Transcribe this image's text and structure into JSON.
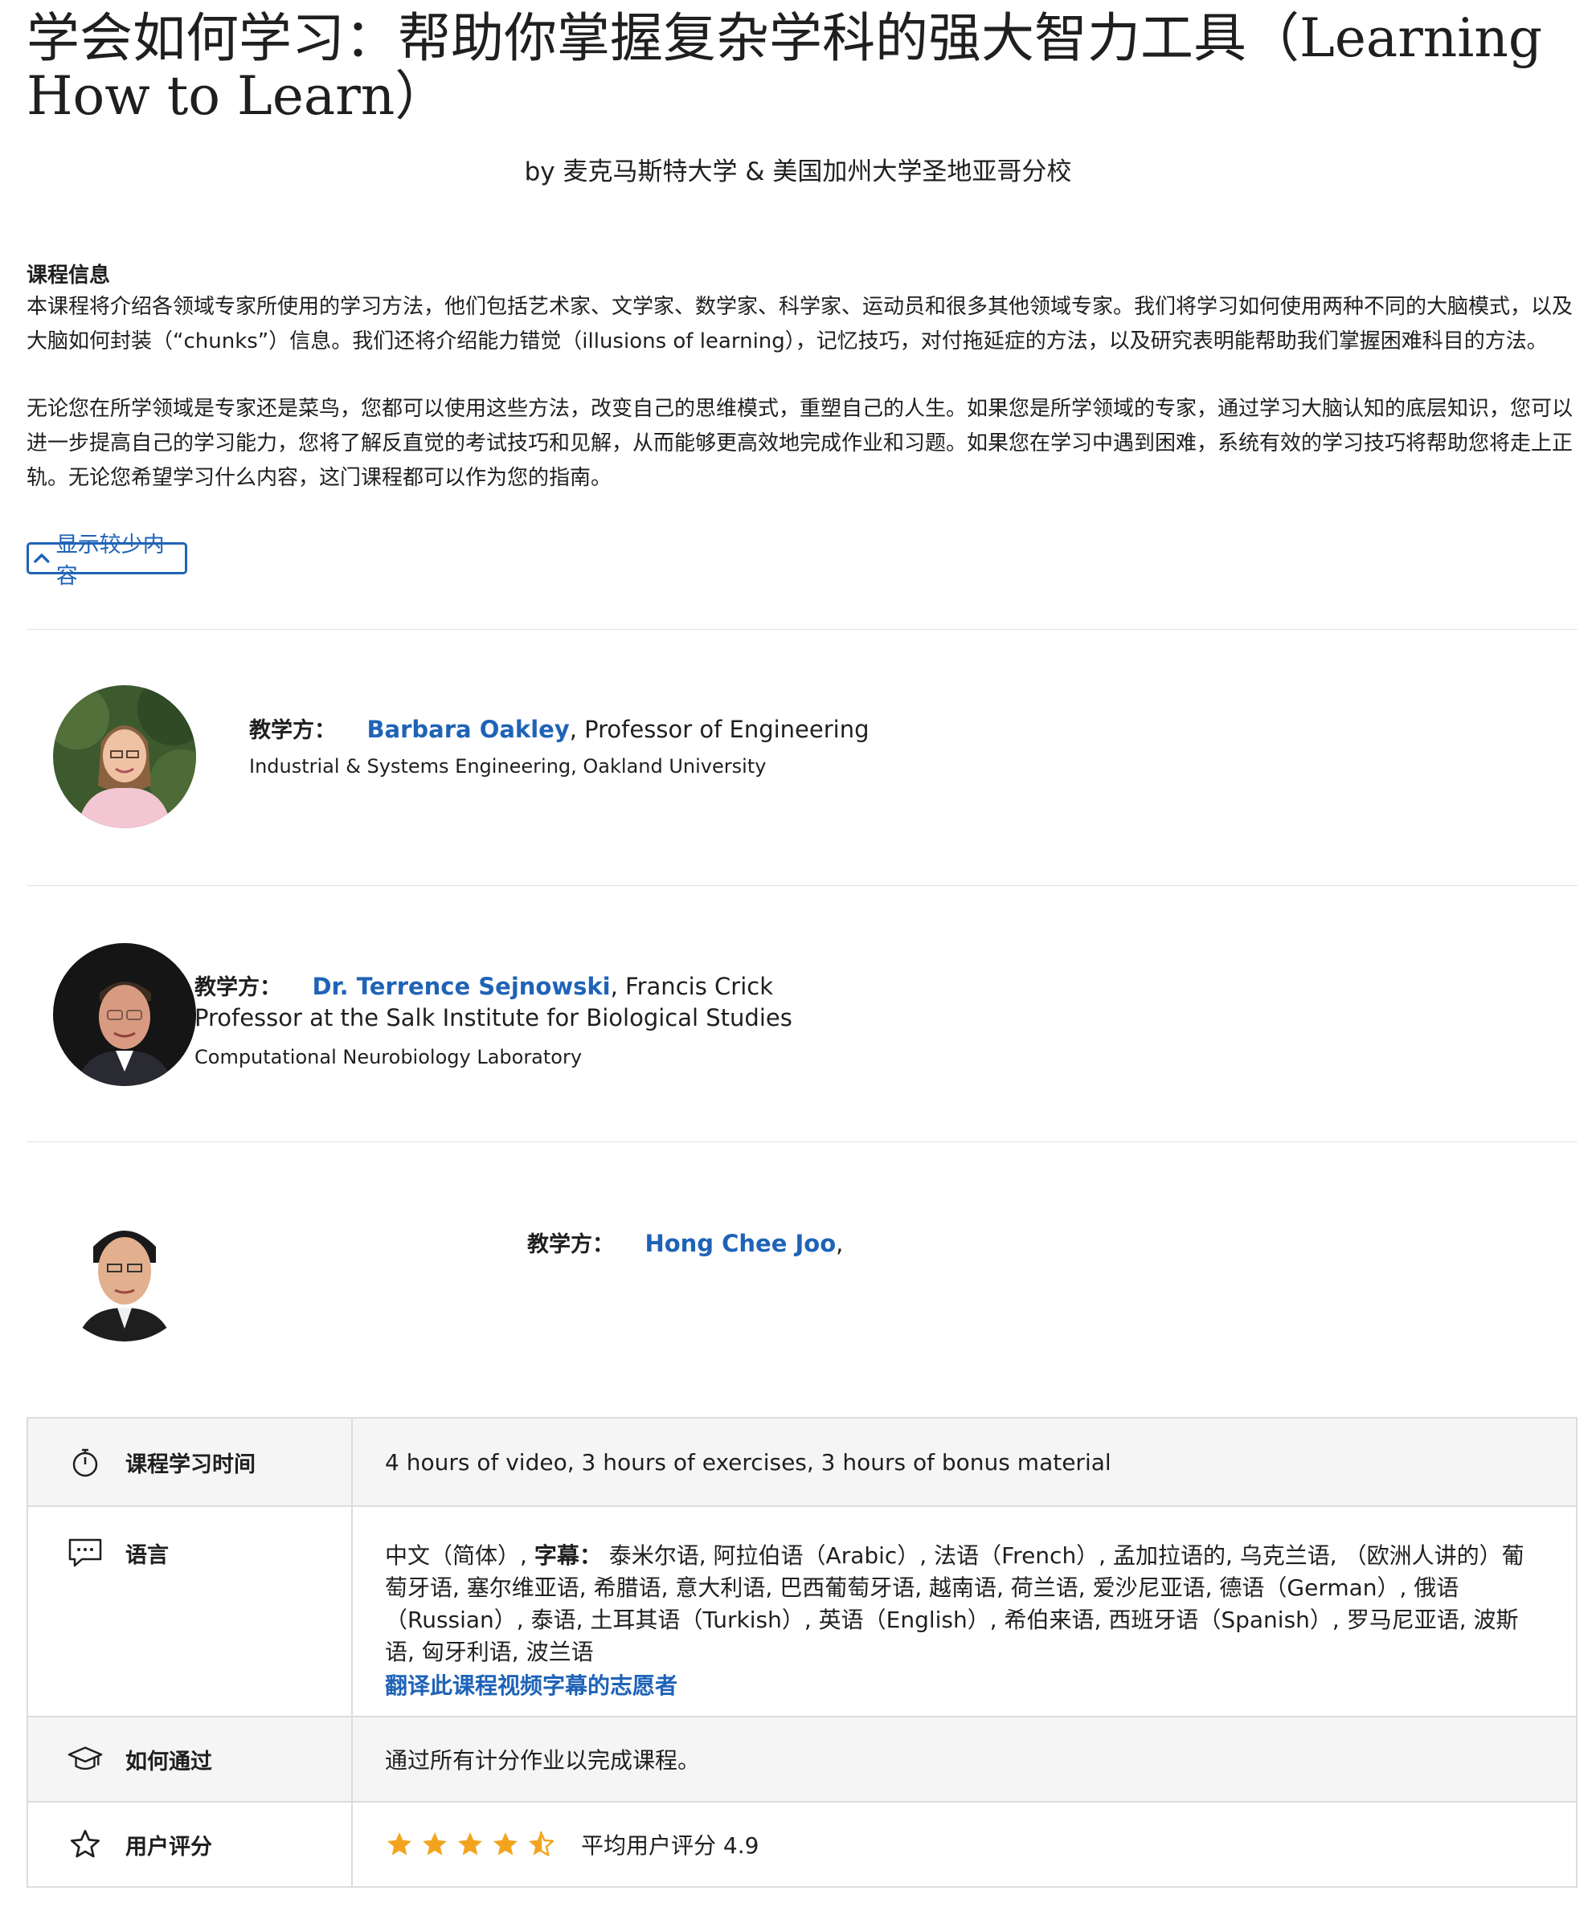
{
  "course": {
    "title": "学会如何学习：帮助你掌握复杂学科的强大智力工具（Learning How to Learn）",
    "byline": "by 麦克马斯特大学 & 美国加州大学圣地亚哥分校"
  },
  "about": {
    "heading": "课程信息",
    "paragraph1": "本课程将介绍各领域专家所使用的学习方法，他们包括艺术家、文学家、数学家、科学家、运动员和很多其他领域专家。我们将学习如何使用两种不同的大脑模式，以及大脑如何封装（“chunks”）信息。我们还将介绍能力错觉（illusions of learning），记忆技巧，对付拖延症的方法，以及研究表明能帮助我们掌握困难科目的方法。",
    "paragraph2": "无论您在所学领域是专家还是菜鸟，您都可以使用这些方法，改变自己的思维模式，重塑自己的人生。如果您是所学领域的专家，通过学习大脑认知的底层知识，您可以进一步提高自己的学习能力，您将了解反直觉的考试技巧和见解，从而能够更高效地完成作业和习题。如果您在学习中遇到困难，系统有效的学习技巧将帮助您将走上正轨。无论您希望学习什么内容，这门课程都可以作为您的指南。",
    "show_less": "显示较少内容"
  },
  "instructors": [
    {
      "label": "教学方：",
      "name": "Barbara Oakley",
      "title": ", Professor of Engineering",
      "org": "Industrial & Systems Engineering, Oakland University"
    },
    {
      "label": "教学方：",
      "name": "Dr. Terrence Sejnowski",
      "title": ", Francis Crick",
      "title2": "Professor at the Salk Institute for Biological Studies",
      "org": "Computational Neurobiology Laboratory"
    },
    {
      "label": "教学方：",
      "name": "Hong Chee Joo",
      "title": ","
    }
  ],
  "info": {
    "duration_label": "课程学习时间",
    "duration_value": "4 hours of video, 3 hours of exercises, 3 hours of bonus material",
    "language_label": "语言",
    "language_primary": "中文（简体）, ",
    "subtitles_label": "字幕：",
    "subtitles_value": "泰米尔语, 阿拉伯语（Arabic）, 法语（French）, 孟加拉语的, 乌克兰语, （欧洲人讲的）葡萄牙语, 塞尔维亚语, 希腊语, 意大利语, 巴西葡萄牙语, 越南语, 荷兰语, 爱沙尼亚语, 德语（German）, 俄语（Russian）, 泰语, 土耳其语（Turkish）, 英语（English）, 希伯来语, 西班牙语（Spanish）, 罗马尼亚语, 波斯语, 匈牙利语, 波兰语",
    "volunteer_link": "翻译此课程视频字幕的志愿者",
    "pass_label": "如何通过",
    "pass_value": "通过所有计分作业以完成课程。",
    "rating_label": "用户评分",
    "rating_text": "平均用户评分 4.9",
    "rating_value": 4.5
  },
  "colors": {
    "link": "#1f63b7",
    "star": "#f3a41f",
    "border": "#dcdcdc",
    "shade": "#f5f5f5"
  },
  "icons": [
    "chevron-up-icon",
    "stopwatch-icon",
    "chat-bubble-icon",
    "graduation-cap-icon",
    "star-outline-icon",
    "star-icon",
    "half-star-icon"
  ]
}
